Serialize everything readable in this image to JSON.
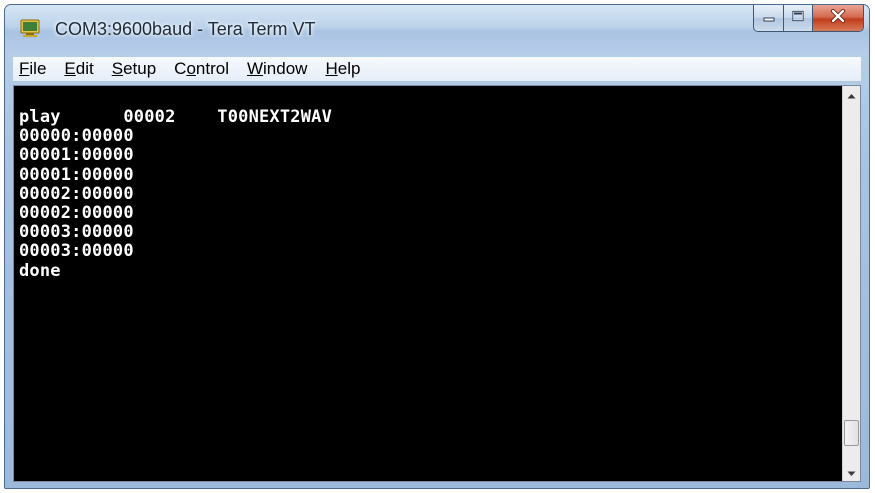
{
  "window": {
    "title": "COM3:9600baud - Tera Term VT",
    "app_icon": "tera-term-icon"
  },
  "title_controls": {
    "minimize_icon": "minimize-icon",
    "maximize_icon": "maximize-icon",
    "close_icon": "close-icon",
    "close_color": "#c13d1d"
  },
  "menubar": {
    "items": [
      {
        "pre": "",
        "key": "F",
        "post": "ile"
      },
      {
        "pre": "",
        "key": "E",
        "post": "dit"
      },
      {
        "pre": "",
        "key": "S",
        "post": "etup"
      },
      {
        "pre": "C",
        "key": "o",
        "post": "ntrol"
      },
      {
        "pre": "",
        "key": "W",
        "post": "indow"
      },
      {
        "pre": "",
        "key": "H",
        "post": "elp"
      }
    ]
  },
  "terminal": {
    "background": "#000000",
    "foreground": "#ffffff",
    "lines": [
      "play      00002    T00NEXT2WAV",
      "00000:00000",
      "00001:00000",
      "00001:00000",
      "00002:00000",
      "00002:00000",
      "00003:00000",
      "00003:00000",
      "done"
    ]
  },
  "scrollbar": {
    "up_icon": "scroll-up-arrow-icon",
    "down_icon": "scroll-down-arrow-icon"
  }
}
